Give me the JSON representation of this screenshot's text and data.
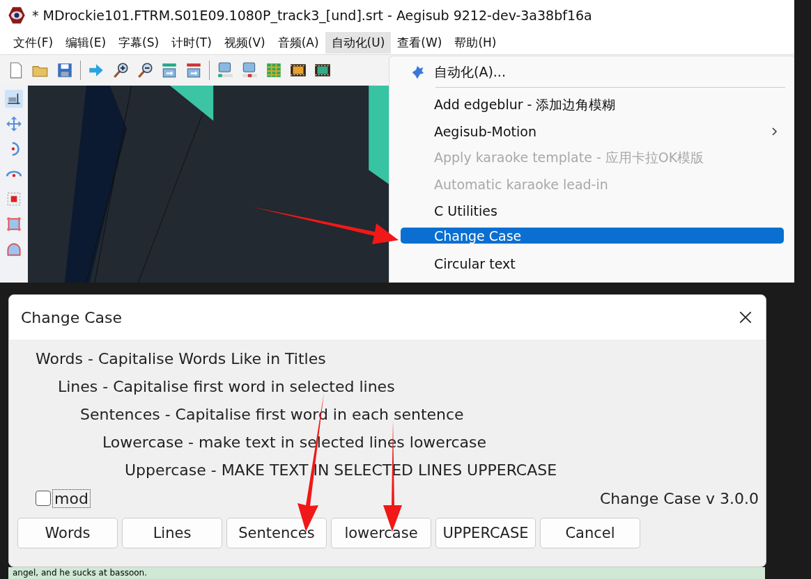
{
  "window": {
    "title": "* MDrockie101.FTRM.S01E09.1080P_track3_[und].srt - Aegisub 9212-dev-3a38bf16a"
  },
  "menu_bar": [
    {
      "label": "文件(F)",
      "selected": false
    },
    {
      "label": "编辑(E)",
      "selected": false
    },
    {
      "label": "字幕(S)",
      "selected": false
    },
    {
      "label": "计时(T)",
      "selected": false
    },
    {
      "label": "视频(V)",
      "selected": false
    },
    {
      "label": "音频(A)",
      "selected": false
    },
    {
      "label": "自动化(U)",
      "selected": true
    },
    {
      "label": "查看(W)",
      "selected": false
    },
    {
      "label": "帮助(H)",
      "selected": false
    }
  ],
  "automation_menu": [
    {
      "label": "自动化(A)...",
      "kind": "command",
      "disabled": false,
      "selected": false
    },
    {
      "label": "Add edgeblur - 添加边角模糊",
      "kind": "script",
      "disabled": false,
      "selected": false
    },
    {
      "label": "Aegisub-Motion",
      "kind": "submenu",
      "disabled": false,
      "selected": false
    },
    {
      "label": "Apply karaoke template - 应用卡拉OK模版",
      "kind": "script",
      "disabled": true,
      "selected": false
    },
    {
      "label": "Automatic karaoke lead-in",
      "kind": "script",
      "disabled": true,
      "selected": false
    },
    {
      "label": "C Utilities",
      "kind": "script",
      "disabled": false,
      "selected": false
    },
    {
      "label": "Change Case",
      "kind": "script",
      "disabled": false,
      "selected": true
    },
    {
      "label": "Circular text",
      "kind": "script",
      "disabled": false,
      "selected": false
    }
  ],
  "dialog": {
    "title": "Change Case",
    "descriptions": [
      "Words - Capitalise Words Like in Titles",
      "Lines - Capitalise first word in selected lines",
      "Sentences - Capitalise first word in each sentence",
      "Lowercase - make text in selected lines lowercase",
      "Uppercase - MAKE TEXT IN SELECTED LINES UPPERCASE"
    ],
    "mod_checkbox": {
      "label": "mod",
      "checked": false
    },
    "version": "Change Case v 3.0.0",
    "buttons": [
      "Words",
      "Lines",
      "Sentences",
      "lowercase",
      "UPPERCASE",
      "Cancel"
    ]
  },
  "background_subtitle": "angel, and he sucks at bassoon."
}
